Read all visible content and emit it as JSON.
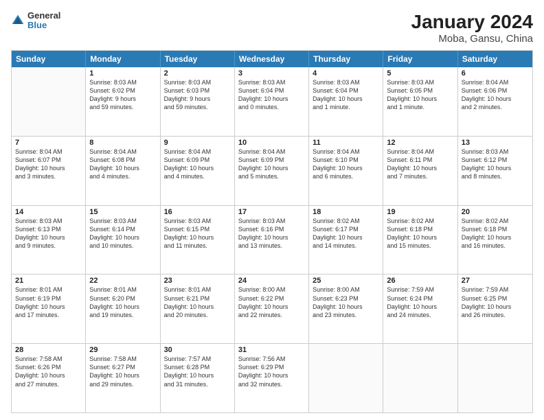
{
  "header": {
    "logo_line1": "General",
    "logo_line2": "Blue",
    "title": "January 2024",
    "subtitle": "Moba, Gansu, China"
  },
  "days_of_week": [
    "Sunday",
    "Monday",
    "Tuesday",
    "Wednesday",
    "Thursday",
    "Friday",
    "Saturday"
  ],
  "weeks": [
    [
      {
        "day": "",
        "info": ""
      },
      {
        "day": "1",
        "info": "Sunrise: 8:03 AM\nSunset: 6:02 PM\nDaylight: 9 hours\nand 59 minutes."
      },
      {
        "day": "2",
        "info": "Sunrise: 8:03 AM\nSunset: 6:03 PM\nDaylight: 9 hours\nand 59 minutes."
      },
      {
        "day": "3",
        "info": "Sunrise: 8:03 AM\nSunset: 6:04 PM\nDaylight: 10 hours\nand 0 minutes."
      },
      {
        "day": "4",
        "info": "Sunrise: 8:03 AM\nSunset: 6:04 PM\nDaylight: 10 hours\nand 1 minute."
      },
      {
        "day": "5",
        "info": "Sunrise: 8:03 AM\nSunset: 6:05 PM\nDaylight: 10 hours\nand 1 minute."
      },
      {
        "day": "6",
        "info": "Sunrise: 8:04 AM\nSunset: 6:06 PM\nDaylight: 10 hours\nand 2 minutes."
      }
    ],
    [
      {
        "day": "7",
        "info": "Sunrise: 8:04 AM\nSunset: 6:07 PM\nDaylight: 10 hours\nand 3 minutes."
      },
      {
        "day": "8",
        "info": "Sunrise: 8:04 AM\nSunset: 6:08 PM\nDaylight: 10 hours\nand 4 minutes."
      },
      {
        "day": "9",
        "info": "Sunrise: 8:04 AM\nSunset: 6:09 PM\nDaylight: 10 hours\nand 4 minutes."
      },
      {
        "day": "10",
        "info": "Sunrise: 8:04 AM\nSunset: 6:09 PM\nDaylight: 10 hours\nand 5 minutes."
      },
      {
        "day": "11",
        "info": "Sunrise: 8:04 AM\nSunset: 6:10 PM\nDaylight: 10 hours\nand 6 minutes."
      },
      {
        "day": "12",
        "info": "Sunrise: 8:04 AM\nSunset: 6:11 PM\nDaylight: 10 hours\nand 7 minutes."
      },
      {
        "day": "13",
        "info": "Sunrise: 8:03 AM\nSunset: 6:12 PM\nDaylight: 10 hours\nand 8 minutes."
      }
    ],
    [
      {
        "day": "14",
        "info": "Sunrise: 8:03 AM\nSunset: 6:13 PM\nDaylight: 10 hours\nand 9 minutes."
      },
      {
        "day": "15",
        "info": "Sunrise: 8:03 AM\nSunset: 6:14 PM\nDaylight: 10 hours\nand 10 minutes."
      },
      {
        "day": "16",
        "info": "Sunrise: 8:03 AM\nSunset: 6:15 PM\nDaylight: 10 hours\nand 11 minutes."
      },
      {
        "day": "17",
        "info": "Sunrise: 8:03 AM\nSunset: 6:16 PM\nDaylight: 10 hours\nand 13 minutes."
      },
      {
        "day": "18",
        "info": "Sunrise: 8:02 AM\nSunset: 6:17 PM\nDaylight: 10 hours\nand 14 minutes."
      },
      {
        "day": "19",
        "info": "Sunrise: 8:02 AM\nSunset: 6:18 PM\nDaylight: 10 hours\nand 15 minutes."
      },
      {
        "day": "20",
        "info": "Sunrise: 8:02 AM\nSunset: 6:18 PM\nDaylight: 10 hours\nand 16 minutes."
      }
    ],
    [
      {
        "day": "21",
        "info": "Sunrise: 8:01 AM\nSunset: 6:19 PM\nDaylight: 10 hours\nand 17 minutes."
      },
      {
        "day": "22",
        "info": "Sunrise: 8:01 AM\nSunset: 6:20 PM\nDaylight: 10 hours\nand 19 minutes."
      },
      {
        "day": "23",
        "info": "Sunrise: 8:01 AM\nSunset: 6:21 PM\nDaylight: 10 hours\nand 20 minutes."
      },
      {
        "day": "24",
        "info": "Sunrise: 8:00 AM\nSunset: 6:22 PM\nDaylight: 10 hours\nand 22 minutes."
      },
      {
        "day": "25",
        "info": "Sunrise: 8:00 AM\nSunset: 6:23 PM\nDaylight: 10 hours\nand 23 minutes."
      },
      {
        "day": "26",
        "info": "Sunrise: 7:59 AM\nSunset: 6:24 PM\nDaylight: 10 hours\nand 24 minutes."
      },
      {
        "day": "27",
        "info": "Sunrise: 7:59 AM\nSunset: 6:25 PM\nDaylight: 10 hours\nand 26 minutes."
      }
    ],
    [
      {
        "day": "28",
        "info": "Sunrise: 7:58 AM\nSunset: 6:26 PM\nDaylight: 10 hours\nand 27 minutes."
      },
      {
        "day": "29",
        "info": "Sunrise: 7:58 AM\nSunset: 6:27 PM\nDaylight: 10 hours\nand 29 minutes."
      },
      {
        "day": "30",
        "info": "Sunrise: 7:57 AM\nSunset: 6:28 PM\nDaylight: 10 hours\nand 31 minutes."
      },
      {
        "day": "31",
        "info": "Sunrise: 7:56 AM\nSunset: 6:29 PM\nDaylight: 10 hours\nand 32 minutes."
      },
      {
        "day": "",
        "info": ""
      },
      {
        "day": "",
        "info": ""
      },
      {
        "day": "",
        "info": ""
      }
    ]
  ]
}
